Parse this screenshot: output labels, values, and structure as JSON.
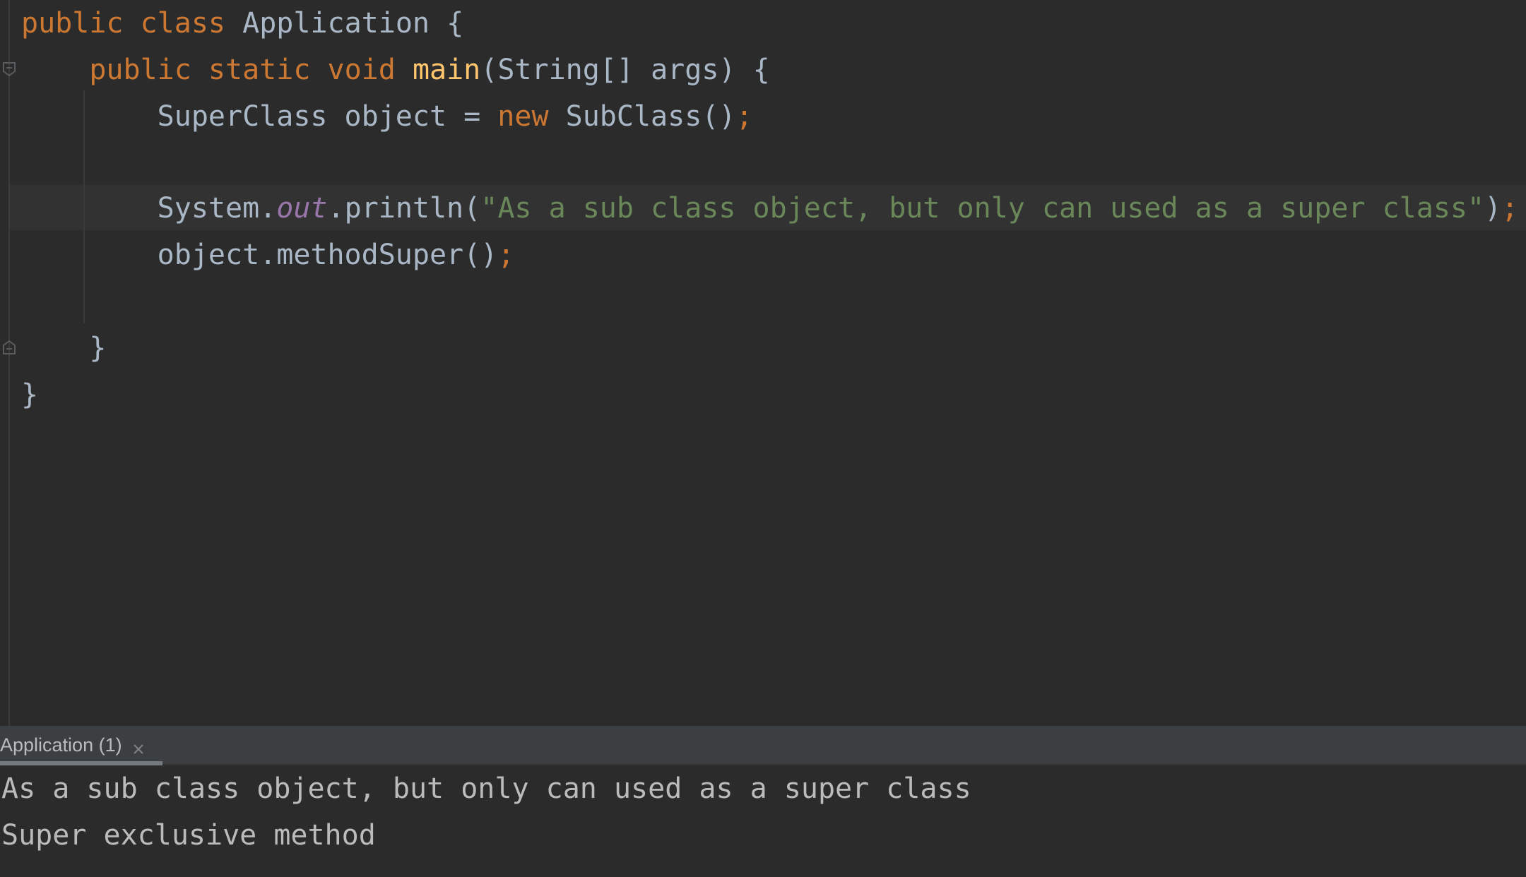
{
  "editor": {
    "lines": [
      {
        "tokens": [
          "public",
          "class",
          "Application",
          "{"
        ]
      },
      {
        "tokens": [
          "public",
          "static",
          "void",
          "main",
          "(String[] args) {"
        ]
      },
      {
        "tokens": [
          "SuperClass object = ",
          "new",
          " SubClass()",
          ";"
        ]
      },
      {
        "tokens": []
      },
      {
        "tokens": [
          "System.",
          "out",
          ".println(",
          "\"As a sub class object, but only can used as a super class\"",
          ")",
          ";"
        ]
      },
      {
        "tokens": [
          "object.methodSuper()",
          ";"
        ]
      },
      {
        "tokens": []
      },
      {
        "tokens": [
          "}"
        ]
      },
      {
        "tokens": [
          "}"
        ]
      }
    ]
  },
  "run_panel": {
    "tab_label": "Application (1)",
    "close_icon": "close-icon",
    "output": [
      "As a sub class object, but only can used as a super class",
      "Super exclusive method"
    ]
  },
  "colors": {
    "background": "#2b2b2b",
    "keyword": "#cc7832",
    "function": "#ffc66d",
    "string": "#6a8759",
    "field": "#9876aa",
    "text": "#a9b7c6",
    "console_text": "#bbbbbb",
    "tabbar": "#3c3f41"
  }
}
